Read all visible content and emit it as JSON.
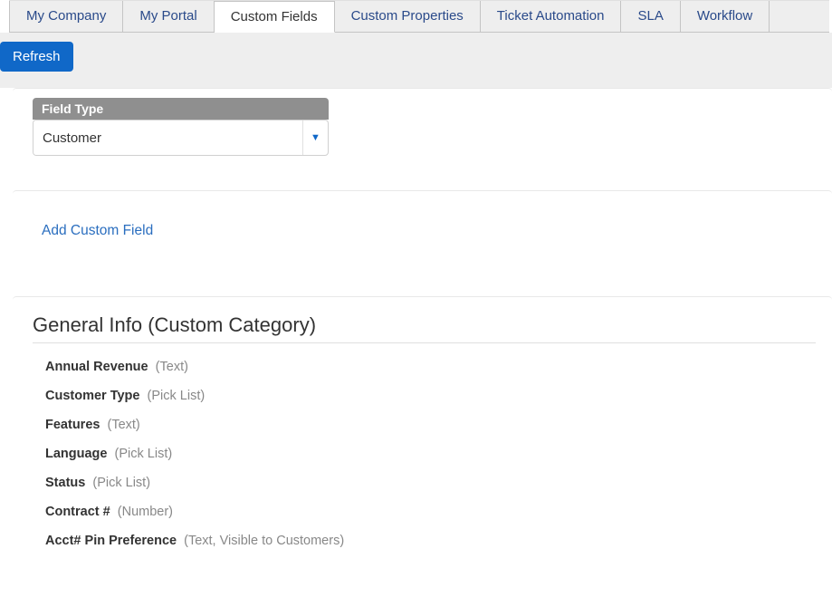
{
  "tabs": [
    {
      "label": "My Company",
      "active": false
    },
    {
      "label": "My Portal",
      "active": false
    },
    {
      "label": "Custom Fields",
      "active": true
    },
    {
      "label": "Custom Properties",
      "active": false
    },
    {
      "label": "Ticket Automation",
      "active": false
    },
    {
      "label": "SLA",
      "active": false
    },
    {
      "label": "Workflow",
      "active": false
    }
  ],
  "actions": {
    "refresh_label": "Refresh",
    "add_custom_field_label": "Add Custom Field"
  },
  "field_type": {
    "header": "Field Type",
    "value": "Customer"
  },
  "category": {
    "title": "General Info (Custom Category)",
    "fields": [
      {
        "name": "Annual Revenue",
        "meta": "(Text)"
      },
      {
        "name": "Customer Type",
        "meta": "(Pick List)"
      },
      {
        "name": "Features",
        "meta": "(Text)"
      },
      {
        "name": "Language",
        "meta": "(Pick List)"
      },
      {
        "name": "Status",
        "meta": "(Pick List)"
      },
      {
        "name": "Contract #",
        "meta": "(Number)"
      },
      {
        "name": "Acct# Pin Preference",
        "meta": "(Text, Visible to Customers)"
      }
    ]
  }
}
